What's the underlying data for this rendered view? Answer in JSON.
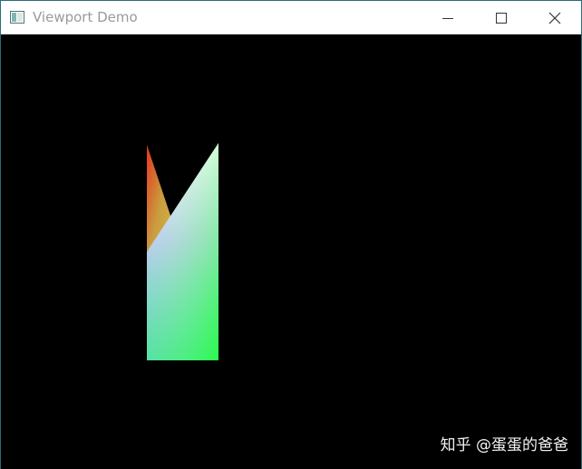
{
  "window": {
    "title": "Viewport Demo",
    "icon": "app-window-icon",
    "controls": [
      "minimize-icon",
      "maximize-icon",
      "close-icon"
    ]
  },
  "scene": {
    "background": "#000000",
    "shapes": [
      {
        "name": "gradient-triangle-left",
        "colors": [
          "#e4381f",
          "#c99d3e",
          "#d7b245"
        ]
      },
      {
        "name": "gradient-quad-right",
        "colors": [
          "#ffffff",
          "#b9c0f6",
          "#21c9a4",
          "#2cff44"
        ]
      }
    ]
  },
  "watermark": {
    "text": "知乎 @蛋蛋的爸爸"
  }
}
